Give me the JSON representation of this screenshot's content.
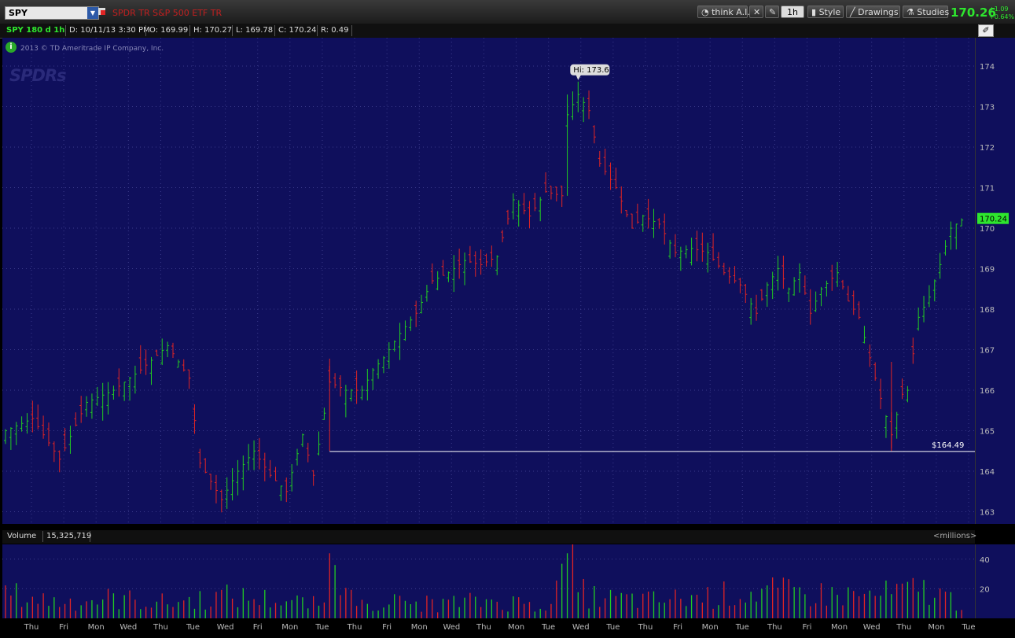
{
  "toolbar": {
    "symbol": "SPY",
    "description": "SPDR TR S&P 500 ETF TR",
    "think": "think A.I.",
    "interval": "1h",
    "style": "Style",
    "drawings": "Drawings",
    "studies": "Studies",
    "last_price": "170.26",
    "change_abs": "+1.09",
    "change_pct": "+0.64%"
  },
  "infobar": {
    "chart_id": "SPY 180 d 1h",
    "date": "D: 10/11/13 3:30 PM",
    "open": "O: 169.99",
    "high": "H: 170.27",
    "low": "L: 169.78",
    "close": "C: 170.24",
    "range": "R: 0.49"
  },
  "watermark": {
    "copyright": "2013 © TD Ameritrade IP Company, Inc.",
    "logo": "SPDRs"
  },
  "price_panel": {
    "hi_label": "Hi: 173.6",
    "support_label": "$164.49",
    "current_label": "170.24",
    "y_ticks": [
      "174",
      "173",
      "172",
      "171",
      "170",
      "169",
      "168",
      "167",
      "166",
      "165",
      "164",
      "163"
    ]
  },
  "volume_panel": {
    "title": "Volume",
    "value": "15,325,719",
    "unit": "<millions>",
    "y_ticks": [
      "40",
      "20"
    ]
  },
  "date_axis": [
    "Thu",
    "Fri",
    "Mon",
    "Wed",
    "Thu",
    "Tue",
    "Wed",
    "Fri",
    "Mon",
    "Tue",
    "Thu",
    "Fri",
    "Mon",
    "Wed",
    "Thu",
    "Mon",
    "Tue",
    "Wed",
    "Tue",
    "Thu",
    "Fri",
    "Mon",
    "Tue",
    "Thu",
    "Fri",
    "Mon",
    "Wed",
    "Thu",
    "Mon",
    "Tue"
  ],
  "colors": {
    "up": "#22cc22",
    "down": "#e02424",
    "bg": "#0f0f5c",
    "grid": "#3a3a8a",
    "accent": "#2ee62e"
  },
  "chart_data": {
    "type": "ohlc",
    "ylim": [
      162.7,
      174.7
    ],
    "trend": [
      [
        0,
        165.0
      ],
      [
        5,
        165.3
      ],
      [
        10,
        164.3
      ],
      [
        15,
        165.7
      ],
      [
        20,
        166.0
      ],
      [
        25,
        166.5
      ],
      [
        30,
        167.1
      ],
      [
        34,
        166.3
      ],
      [
        36,
        164.2
      ],
      [
        40,
        163.3
      ],
      [
        43,
        164.0
      ],
      [
        46,
        164.5
      ],
      [
        49,
        163.9
      ],
      [
        52,
        163.5
      ],
      [
        55,
        164.9
      ],
      [
        57,
        163.9
      ],
      [
        60,
        166.2
      ],
      [
        63,
        166.0
      ],
      [
        66,
        166.0
      ],
      [
        68,
        166.5
      ],
      [
        70,
        166.8
      ],
      [
        73,
        167.4
      ],
      [
        76,
        167.9
      ],
      [
        79,
        168.7
      ],
      [
        82,
        168.9
      ],
      [
        85,
        169.2
      ],
      [
        88,
        169.1
      ],
      [
        91,
        169.3
      ],
      [
        94,
        170.7
      ],
      [
        97,
        170.3
      ],
      [
        100,
        170.9
      ],
      [
        103,
        170.8
      ],
      [
        104,
        172.8
      ],
      [
        106,
        173.3
      ],
      [
        108,
        172.9
      ],
      [
        110,
        171.6
      ],
      [
        113,
        171.0
      ],
      [
        116,
        170.0
      ],
      [
        118,
        170.3
      ],
      [
        121,
        170.1
      ],
      [
        124,
        169.4
      ],
      [
        127,
        169.5
      ],
      [
        130,
        169.4
      ],
      [
        133,
        168.9
      ],
      [
        136,
        168.6
      ],
      [
        139,
        167.9
      ],
      [
        141,
        168.6
      ],
      [
        143,
        169.0
      ],
      [
        145,
        168.5
      ],
      [
        147,
        168.9
      ],
      [
        149,
        167.9
      ],
      [
        151,
        168.5
      ],
      [
        154,
        168.9
      ],
      [
        156,
        168.2
      ],
      [
        158,
        167.8
      ],
      [
        160,
        166.8
      ],
      [
        162,
        165.8
      ],
      [
        164,
        164.9
      ],
      [
        166,
        165.9
      ],
      [
        167,
        166.0
      ],
      [
        169,
        167.8
      ],
      [
        171,
        168.3
      ],
      [
        173,
        169.1
      ],
      [
        175,
        170.0
      ],
      [
        177,
        170.2
      ]
    ],
    "volume_profile": [
      [
        0,
        22
      ],
      [
        10,
        15
      ],
      [
        20,
        18
      ],
      [
        30,
        14
      ],
      [
        40,
        20
      ],
      [
        50,
        17
      ],
      [
        58,
        12
      ],
      [
        60,
        44
      ],
      [
        62,
        18
      ],
      [
        70,
        15
      ],
      [
        80,
        13
      ],
      [
        90,
        16
      ],
      [
        100,
        12
      ],
      [
        104,
        44
      ],
      [
        106,
        24
      ],
      [
        110,
        18
      ],
      [
        120,
        16
      ],
      [
        130,
        20
      ],
      [
        140,
        24
      ],
      [
        150,
        22
      ],
      [
        160,
        20
      ],
      [
        170,
        26
      ],
      [
        177,
        14
      ]
    ]
  }
}
